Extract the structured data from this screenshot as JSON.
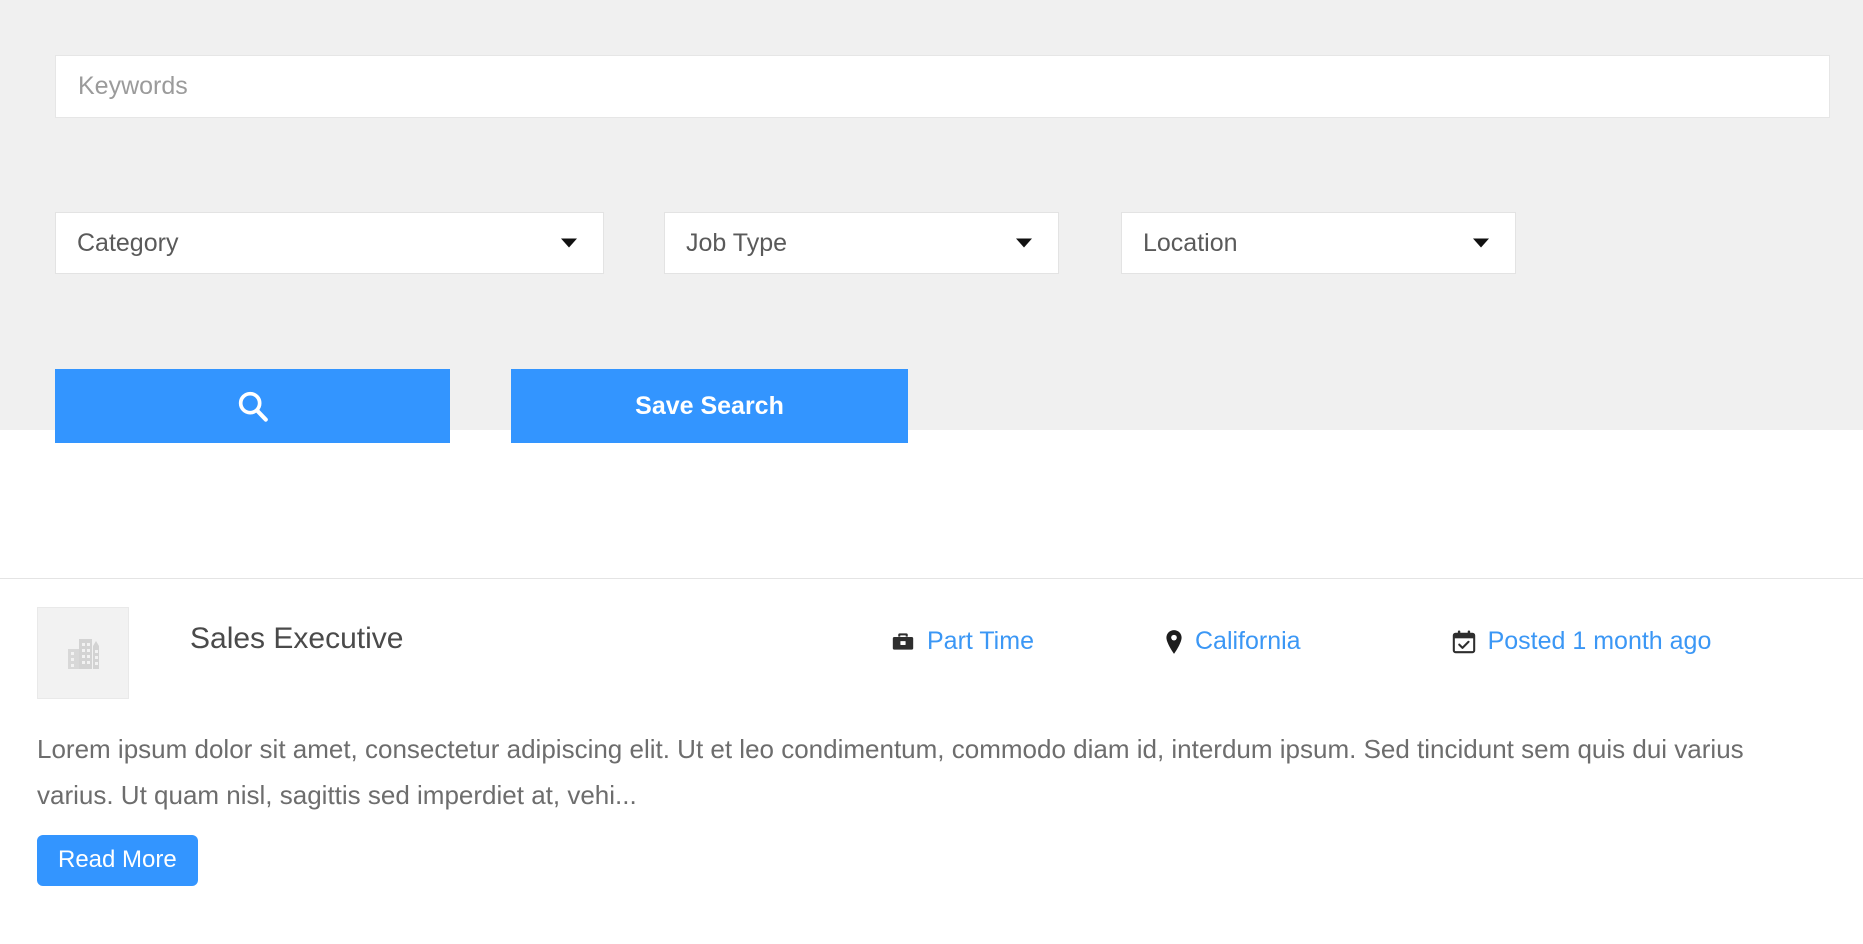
{
  "search": {
    "keywords_placeholder": "Keywords",
    "keywords_value": "",
    "filters": [
      {
        "name": "category",
        "label": "Category"
      },
      {
        "name": "jobtype",
        "label": "Job Type"
      },
      {
        "name": "location",
        "label": "Location"
      }
    ],
    "search_button_icon": "search-icon",
    "save_search_label": "Save Search",
    "accent_color": "#3395ff",
    "panel_background": "#f0f0f0"
  },
  "job": {
    "logo_icon": "company-building-placeholder-icon",
    "title": "Sales Executive",
    "meta": {
      "job_type_icon": "briefcase-icon",
      "job_type": "Part Time",
      "location_icon": "map-pin-icon",
      "location": "California",
      "posted_icon": "calendar-check-icon",
      "posted": "Posted 1 month ago"
    },
    "description": "Lorem ipsum dolor sit amet, consectetur adipiscing elit. Ut et leo condimentum, commodo diam id, interdum ipsum. Sed tincidunt sem quis dui varius varius. Ut quam nisl, sagittis sed imperdiet at, vehi...",
    "read_more_label": "Read More",
    "link_color": "#3b97f5"
  }
}
